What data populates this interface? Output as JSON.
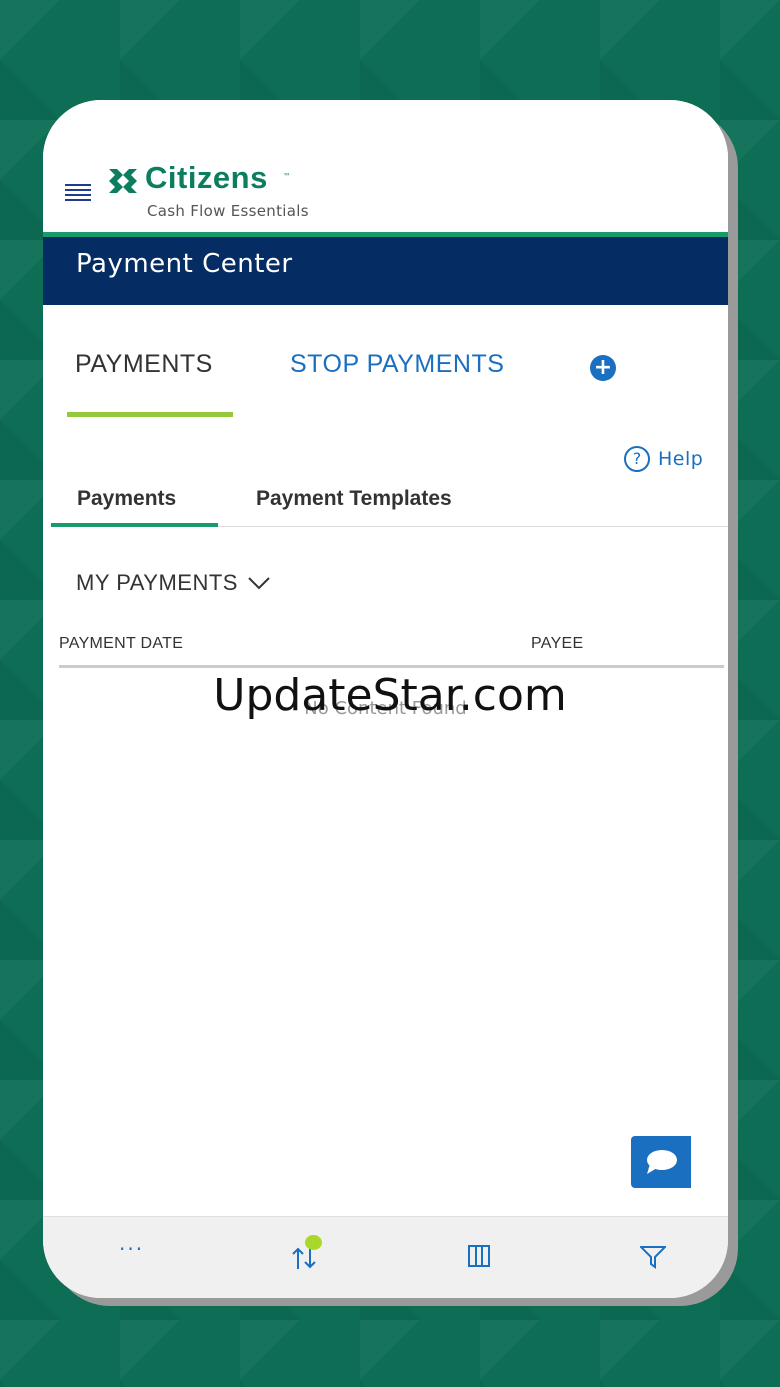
{
  "header": {
    "brand_name": "Citizens",
    "brand_tm": "™",
    "brand_subtitle": "Cash Flow Essentials"
  },
  "title_bar": {
    "title": "Payment Center"
  },
  "top_tabs": [
    {
      "label": "PAYMENTS",
      "active": true
    },
    {
      "label": "STOP PAYMENTS",
      "active": false
    }
  ],
  "help": {
    "label": "Help"
  },
  "sub_tabs": [
    {
      "label": "Payments",
      "active": true
    },
    {
      "label": "Payment Templates",
      "active": false
    }
  ],
  "filter": {
    "label": "MY PAYMENTS"
  },
  "table": {
    "columns": [
      "PAYMENT DATE",
      "PAYEE"
    ],
    "empty_message": "No Content Found"
  },
  "bottom_bar": {
    "icons": [
      "more-icon",
      "sort-icon",
      "columns-icon",
      "filter-icon"
    ]
  },
  "watermark": "UpdateStar.com",
  "colors": {
    "brand_green": "#0c7e5f",
    "navy": "#062d63",
    "link_blue": "#1a6fc0",
    "accent_lime": "#94c83d",
    "background": "#0e6e55"
  }
}
